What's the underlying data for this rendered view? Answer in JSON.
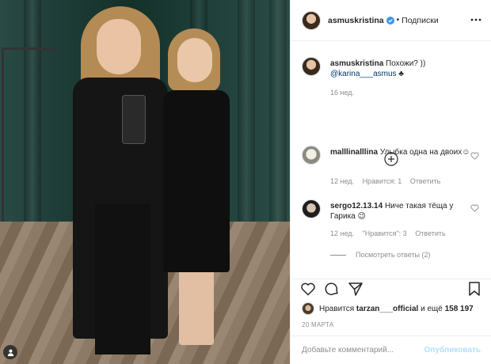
{
  "colors": {
    "accent": "#3897f0",
    "text": "#262626",
    "muted": "#8e8e8e",
    "link": "#003569",
    "publish_disabled": "#b2dffc",
    "divider": "#efefef"
  },
  "header": {
    "username": "asmuskristina",
    "dot": "•",
    "follow_label": "Подписки",
    "more_icon": "more-icon"
  },
  "caption": {
    "username": "asmuskristina",
    "text": "Похожи? ))",
    "mention": "@karina___asmus",
    "emoji": "♣",
    "time": "16 нед."
  },
  "load_more_icon": "plus-circle-icon",
  "comments": [
    {
      "username": "malllinalllina",
      "text": "Улыбка одна на двоих☺",
      "time": "12 нед.",
      "likes": "Нравится: 1",
      "reply": "Ответить"
    },
    {
      "username": "sergo12.13.14",
      "text": "Ниче такая тёща у Гарика 😉",
      "time": "12 нед.",
      "likes": "\"Нравится\": 3",
      "reply": "Ответить"
    }
  ],
  "view_replies": "Посмотреть ответы (2)",
  "actions": {
    "like": "heart-icon",
    "comment": "comment-icon",
    "share": "share-icon",
    "save": "bookmark-icon"
  },
  "likes": {
    "prefix": "Нравится",
    "user": "tarzan___official",
    "middle": "и ещё",
    "count": "158 197"
  },
  "date": "20 МАРТА",
  "add_comment": {
    "placeholder": "Добавьте комментарий...",
    "publish": "Опубликовать"
  }
}
